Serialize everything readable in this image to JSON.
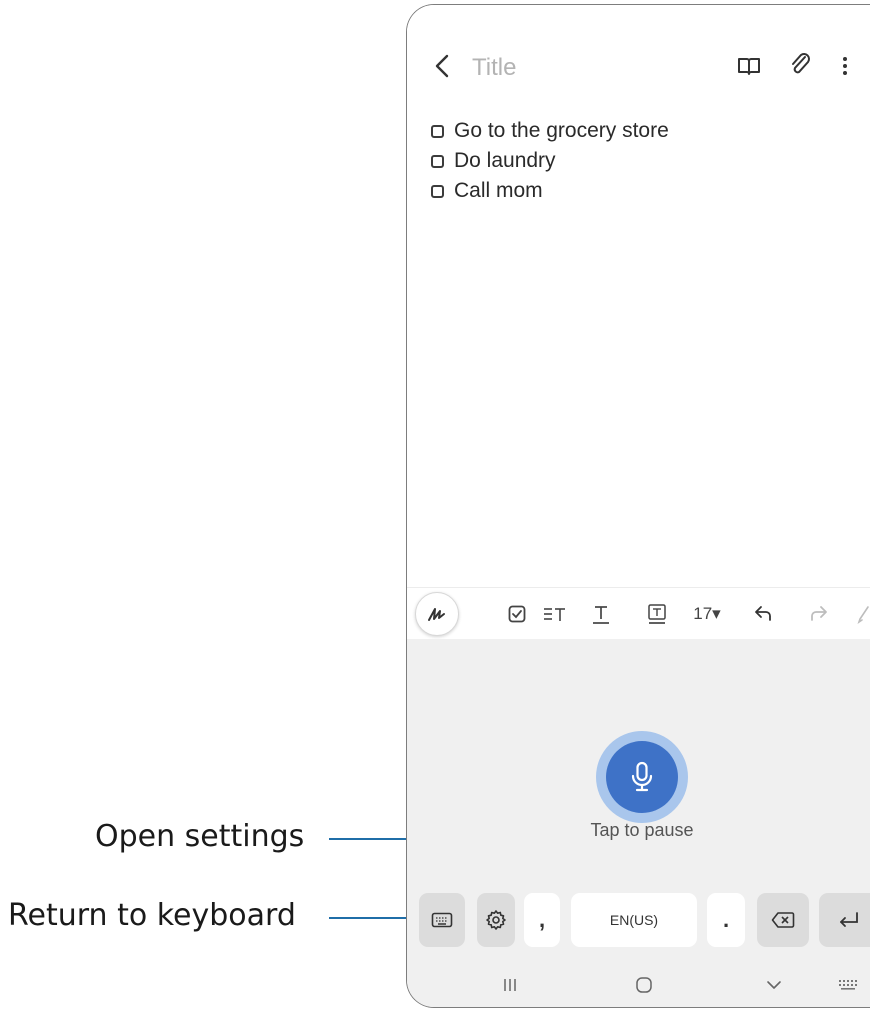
{
  "callouts": {
    "open_settings": "Open settings",
    "return_to_keyboard": "Return to keyboard"
  },
  "note": {
    "title_placeholder": "Title",
    "checklist": [
      {
        "text": "Go to the grocery store",
        "checked": false
      },
      {
        "text": "Do laundry",
        "checked": false
      },
      {
        "text": "Call mom",
        "checked": false
      }
    ],
    "top_icons": [
      "book-icon",
      "paperclip-icon",
      "more-options-icon"
    ]
  },
  "toolbar": {
    "font_size": "17▾",
    "tools": [
      "handwriting-pen-icon",
      "checkbox-tool-icon",
      "paragraph-style-icon",
      "text-style-icon",
      "text-box-icon",
      "font-size-dropdown",
      "undo-icon",
      "redo-icon",
      "eraser-icon"
    ]
  },
  "voice_input": {
    "status": "Tap to pause",
    "language_key": "EN(US)",
    "comma": ",",
    "period": ".",
    "accent_color": "#3e72c7"
  },
  "navigation": [
    "recent-apps-icon",
    "home-icon",
    "back-icon",
    "keyboard-switch-icon"
  ]
}
